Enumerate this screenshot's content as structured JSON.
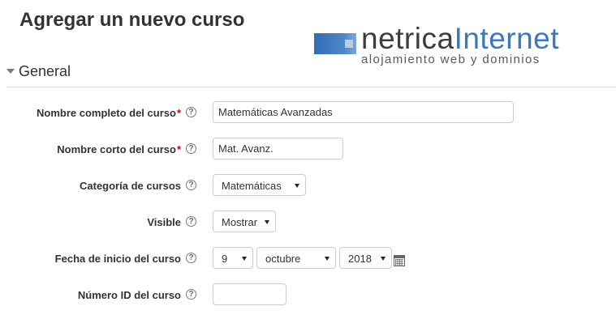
{
  "page": {
    "title": "Agregar un nuevo curso"
  },
  "logo": {
    "word_part1": "netrica",
    "word_part2": "Internet",
    "tagline": "alojamiento web y dominios",
    "colors": {
      "dark": "#3d3d3d",
      "blue": "#3d78bc"
    }
  },
  "section": {
    "title": "General",
    "icon": "caret-down-icon"
  },
  "form": {
    "required_marker": "*",
    "help_glyph": "?",
    "fullname": {
      "label": "Nombre completo del curso",
      "value": "Matemáticas Avanzadas"
    },
    "shortname": {
      "label": "Nombre corto del curso",
      "value": "Mat. Avanz."
    },
    "category": {
      "label": "Categoría de cursos",
      "value": "Matemáticas"
    },
    "visible": {
      "label": "Visible",
      "value": "Mostrar"
    },
    "startdate": {
      "label": "Fecha de inicio del curso",
      "day": "9",
      "month": "octubre",
      "year": "2018",
      "icon": "calendar-icon"
    },
    "idnumber": {
      "label": "Número ID del curso",
      "value": ""
    }
  },
  "colors": {
    "required": "#cc0000",
    "text": "#333333",
    "border": "#cccccc"
  }
}
